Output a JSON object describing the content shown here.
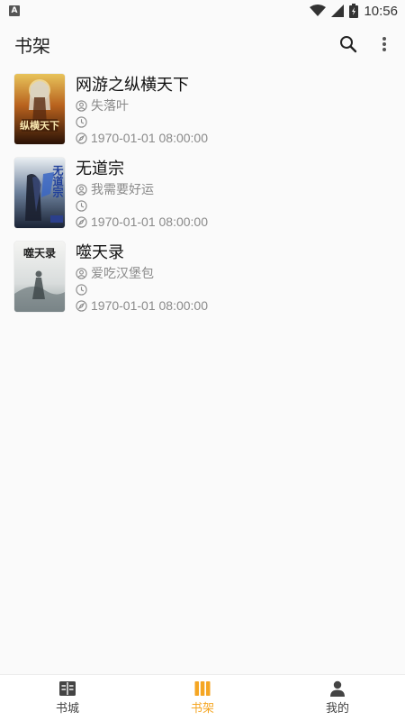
{
  "status_bar": {
    "notification_icon": "A",
    "time": "10:56",
    "icons": [
      "wifi-icon",
      "signal-icon",
      "battery-icon"
    ]
  },
  "app_bar": {
    "title": "书架",
    "actions": [
      "search-icon",
      "more-vert-icon"
    ]
  },
  "books": [
    {
      "title": "网游之纵横天下",
      "author": "失落叶",
      "latest_chapter": "",
      "update_time": "1970-01-01 08:00:00",
      "cover_text": "纵横天下"
    },
    {
      "title": "无道宗",
      "author": "我需要好运",
      "latest_chapter": "",
      "update_time": "1970-01-01 08:00:00",
      "cover_text": "无道宗"
    },
    {
      "title": "噬天录",
      "author": "爱吃汉堡包",
      "latest_chapter": "",
      "update_time": "1970-01-01 08:00:00",
      "cover_text": "噬天录"
    }
  ],
  "bottom_nav": {
    "items": [
      {
        "label": "书城",
        "icon": "book-city-icon",
        "active": false
      },
      {
        "label": "书架",
        "icon": "bookshelf-icon",
        "active": true
      },
      {
        "label": "我的",
        "icon": "person-icon",
        "active": false
      }
    ]
  },
  "colors": {
    "accent": "#f5a623",
    "background": "#fafafa",
    "text_secondary": "#8a8a8a"
  }
}
